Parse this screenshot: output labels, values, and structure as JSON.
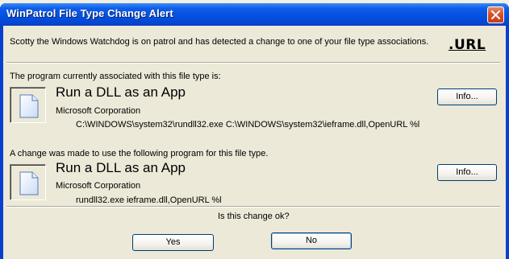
{
  "window": {
    "title": "WinPatrol File Type Change Alert"
  },
  "header": {
    "message": "Scotty the Windows Watchdog is on patrol and has detected a change to one of your file type associations.",
    "extension": ".URL"
  },
  "current": {
    "section_label": "The program currently associated with this file type is:",
    "program_name": "Run a DLL as an App",
    "company": "Microsoft Corporation",
    "command": "C:\\WINDOWS\\system32\\rundll32.exe C:\\WINDOWS\\system32\\ieframe.dll,OpenURL %l",
    "info_label": "Info..."
  },
  "changed": {
    "section_label": "A change was made to use the following program for this file type.",
    "program_name": "Run a DLL as an App",
    "company": "Microsoft Corporation",
    "command": "rundll32.exe ieframe.dll,OpenURL %l",
    "info_label": "Info..."
  },
  "prompt": {
    "question": "Is this change ok?",
    "yes_label": "Yes",
    "no_label": "No"
  },
  "icons": {
    "close": "close-icon",
    "document": "document-icon"
  },
  "colors": {
    "title_bar": "#0551e0",
    "dialog_face": "#ece9d8",
    "close_button": "#d6532b"
  }
}
